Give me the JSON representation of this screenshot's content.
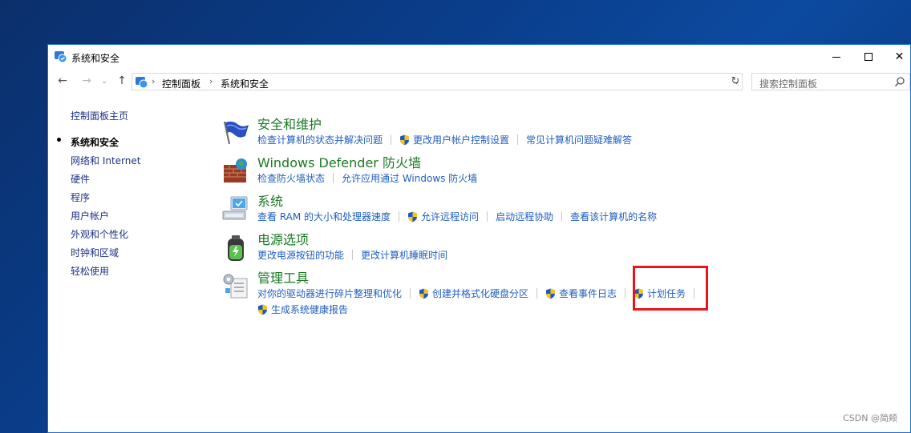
{
  "window": {
    "title": "系统和安全"
  },
  "address": {
    "crumbs": [
      "控制面板",
      "系统和安全"
    ],
    "search_placeholder": "搜索控制面板"
  },
  "sidebar": {
    "home": "控制面板主页",
    "items": [
      {
        "label": "系统和安全",
        "current": true
      },
      {
        "label": "网络和 Internet"
      },
      {
        "label": "硬件"
      },
      {
        "label": "程序"
      },
      {
        "label": "用户帐户"
      },
      {
        "label": "外观和个性化"
      },
      {
        "label": "时钟和区域"
      },
      {
        "label": "轻松使用"
      }
    ]
  },
  "categories": [
    {
      "title": "安全和维护",
      "icon": "flag-icon",
      "links": [
        {
          "label": "检查计算机的状态并解决问题"
        },
        {
          "label": "更改用户帐户控制设置",
          "shield": true
        },
        {
          "label": "常见计算机问题疑难解答"
        }
      ]
    },
    {
      "title": "Windows Defender 防火墙",
      "icon": "firewall-icon",
      "links": [
        {
          "label": "检查防火墙状态"
        },
        {
          "label": "允许应用通过 Windows 防火墙"
        }
      ]
    },
    {
      "title": "系统",
      "icon": "computer-icon",
      "links": [
        {
          "label": "查看 RAM 的大小和处理器速度"
        },
        {
          "label": "允许远程访问",
          "shield": true
        },
        {
          "label": "启动远程协助"
        },
        {
          "label": "查看该计算机的名称"
        }
      ]
    },
    {
      "title": "电源选项",
      "icon": "battery-icon",
      "links": [
        {
          "label": "更改电源按钮的功能"
        },
        {
          "label": "更改计算机睡眠时间"
        }
      ]
    },
    {
      "title": "管理工具",
      "icon": "admin-tools-icon",
      "links": [
        {
          "label": "对你的驱动器进行碎片整理和优化"
        },
        {
          "label": "创建并格式化硬盘分区",
          "shield": true
        },
        {
          "label": "查看事件日志",
          "shield": true
        },
        {
          "label": "计划任务",
          "shield": true
        }
      ],
      "links2": [
        {
          "label": "生成系统健康报告",
          "shield": true
        }
      ]
    }
  ],
  "watermark": "CSDN @简颊",
  "colors": {
    "link": "#1f5fbf",
    "category": "#1a7a24",
    "highlight": "#e8141e",
    "sidebar_link": "#1e3287"
  }
}
